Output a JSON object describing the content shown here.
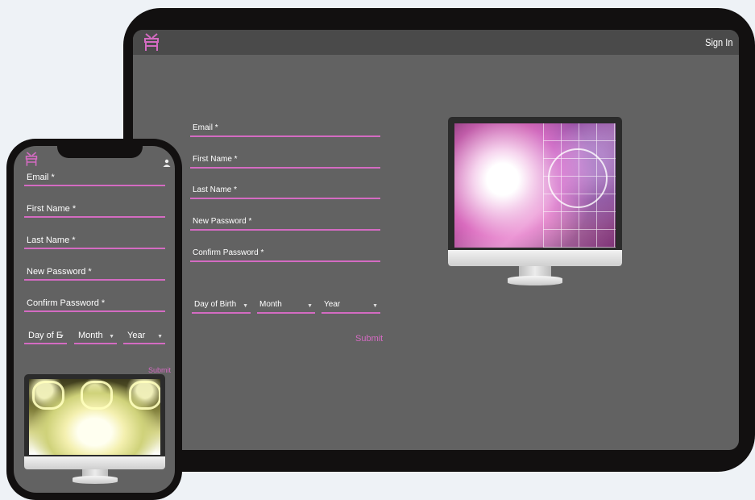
{
  "tablet": {
    "header": {
      "sign_in_label": "Sign In",
      "logo_icon": "brand-logo-icon"
    },
    "form": {
      "email_label": "Email *",
      "first_name_label": "First Name *",
      "last_name_label": "Last Name *",
      "new_password_label": "New Password *",
      "confirm_password_label": "Confirm Password *",
      "day_of_birth_label": "Day of Birth",
      "month_label": "Month",
      "year_label": "Year",
      "submit_label": "Submit"
    }
  },
  "phone": {
    "header": {
      "logo_icon": "brand-logo-icon",
      "account_icon": "user-icon"
    },
    "form": {
      "email_label": "Email *",
      "first_name_label": "First Name *",
      "last_name_label": "Last Name *",
      "new_password_label": "New Password *",
      "confirm_password_label": "Confirm Password *",
      "day_of_birth_label": "Day of E",
      "month_label": "Month",
      "year_label": "Year",
      "submit_label": "Submit"
    }
  },
  "colors": {
    "accent": "#d46bc2",
    "screen_bg": "#626262",
    "header_bg": "#4a4a4a",
    "device_frame": "#121010",
    "page_bg": "#eef2f6"
  }
}
